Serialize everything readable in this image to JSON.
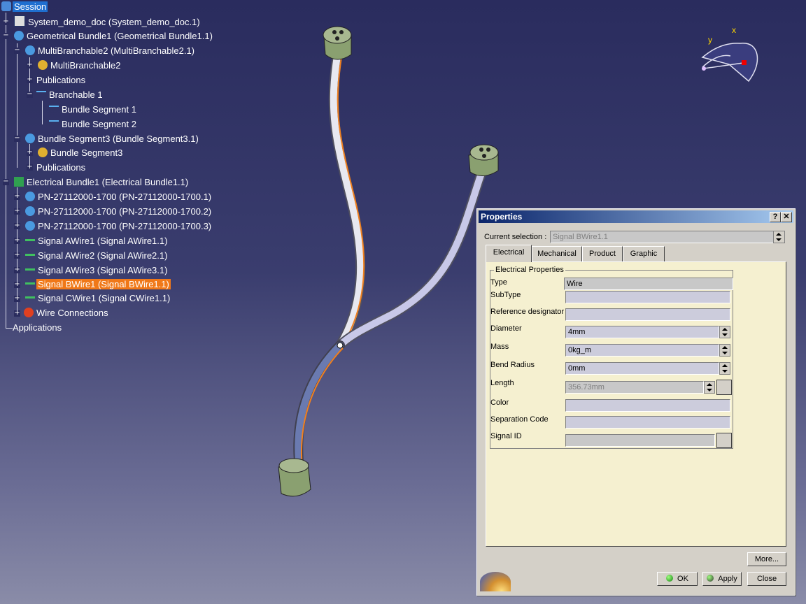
{
  "tree": {
    "items": [
      {
        "label": "Session"
      },
      {
        "label": "System_demo_doc (System_demo_doc.1)"
      },
      {
        "label": "Geometrical Bundle1 (Geometrical Bundle1.1)"
      },
      {
        "label": "MultiBranchable2 (MultiBranchable2.1)"
      },
      {
        "label": "MultiBranchable2"
      },
      {
        "label": "Publications"
      },
      {
        "label": "Branchable 1"
      },
      {
        "label": "Bundle Segment 1"
      },
      {
        "label": "Bundle Segment 2"
      },
      {
        "label": "Bundle Segment3 (Bundle Segment3.1)"
      },
      {
        "label": "Bundle Segment3"
      },
      {
        "label": "Publications"
      },
      {
        "label": "Electrical Bundle1 (Electrical Bundle1.1)"
      },
      {
        "label": "PN-27112000-1700 (PN-27112000-1700.1)"
      },
      {
        "label": "PN-27112000-1700 (PN-27112000-1700.2)"
      },
      {
        "label": "PN-27112000-1700 (PN-27112000-1700.3)"
      },
      {
        "label": "Signal AWire1 (Signal AWire1.1)"
      },
      {
        "label": "Signal AWire2 (Signal AWire2.1)"
      },
      {
        "label": "Signal AWire3 (Signal AWire3.1)"
      },
      {
        "label": "Signal BWire1 (Signal BWire1.1)"
      },
      {
        "label": "Signal CWire1 (Signal CWire1.1)"
      },
      {
        "label": "Wire Connections"
      },
      {
        "label": "Applications"
      }
    ]
  },
  "compass": {
    "x_label": "x",
    "y_label": "y"
  },
  "dialog": {
    "title": "Properties",
    "help_label": "?",
    "close_label": "✕",
    "current_selection_label": "Current selection :",
    "current_selection_value": "Signal BWire1.1",
    "tabs": [
      {
        "label": "Electrical"
      },
      {
        "label": "Mechanical"
      },
      {
        "label": "Product"
      },
      {
        "label": "Graphic"
      }
    ],
    "group_label": "Electrical Properties",
    "fields": {
      "type": {
        "label": "Type",
        "value": "Wire"
      },
      "subtype": {
        "label": "SubType",
        "value": ""
      },
      "refdes": {
        "label": "Reference designator",
        "value": ""
      },
      "diameter": {
        "label": "Diameter",
        "value": "4mm"
      },
      "mass": {
        "label": "Mass",
        "value": "0kg_m"
      },
      "bend": {
        "label": "Bend Radius",
        "value": "0mm"
      },
      "length": {
        "label": "Length",
        "value": "356.73mm"
      },
      "color": {
        "label": "Color",
        "value": ""
      },
      "sepcode": {
        "label": "Separation Code",
        "value": ""
      },
      "signal": {
        "label": "Signal ID",
        "value": ""
      }
    },
    "more_label": "More...",
    "ok_label": "OK",
    "apply_label": "Apply",
    "close_button_label": "Close"
  },
  "colors": {
    "selection": "#f07818",
    "title_bar": "#0a246a",
    "panel": "#f5f0d0"
  }
}
